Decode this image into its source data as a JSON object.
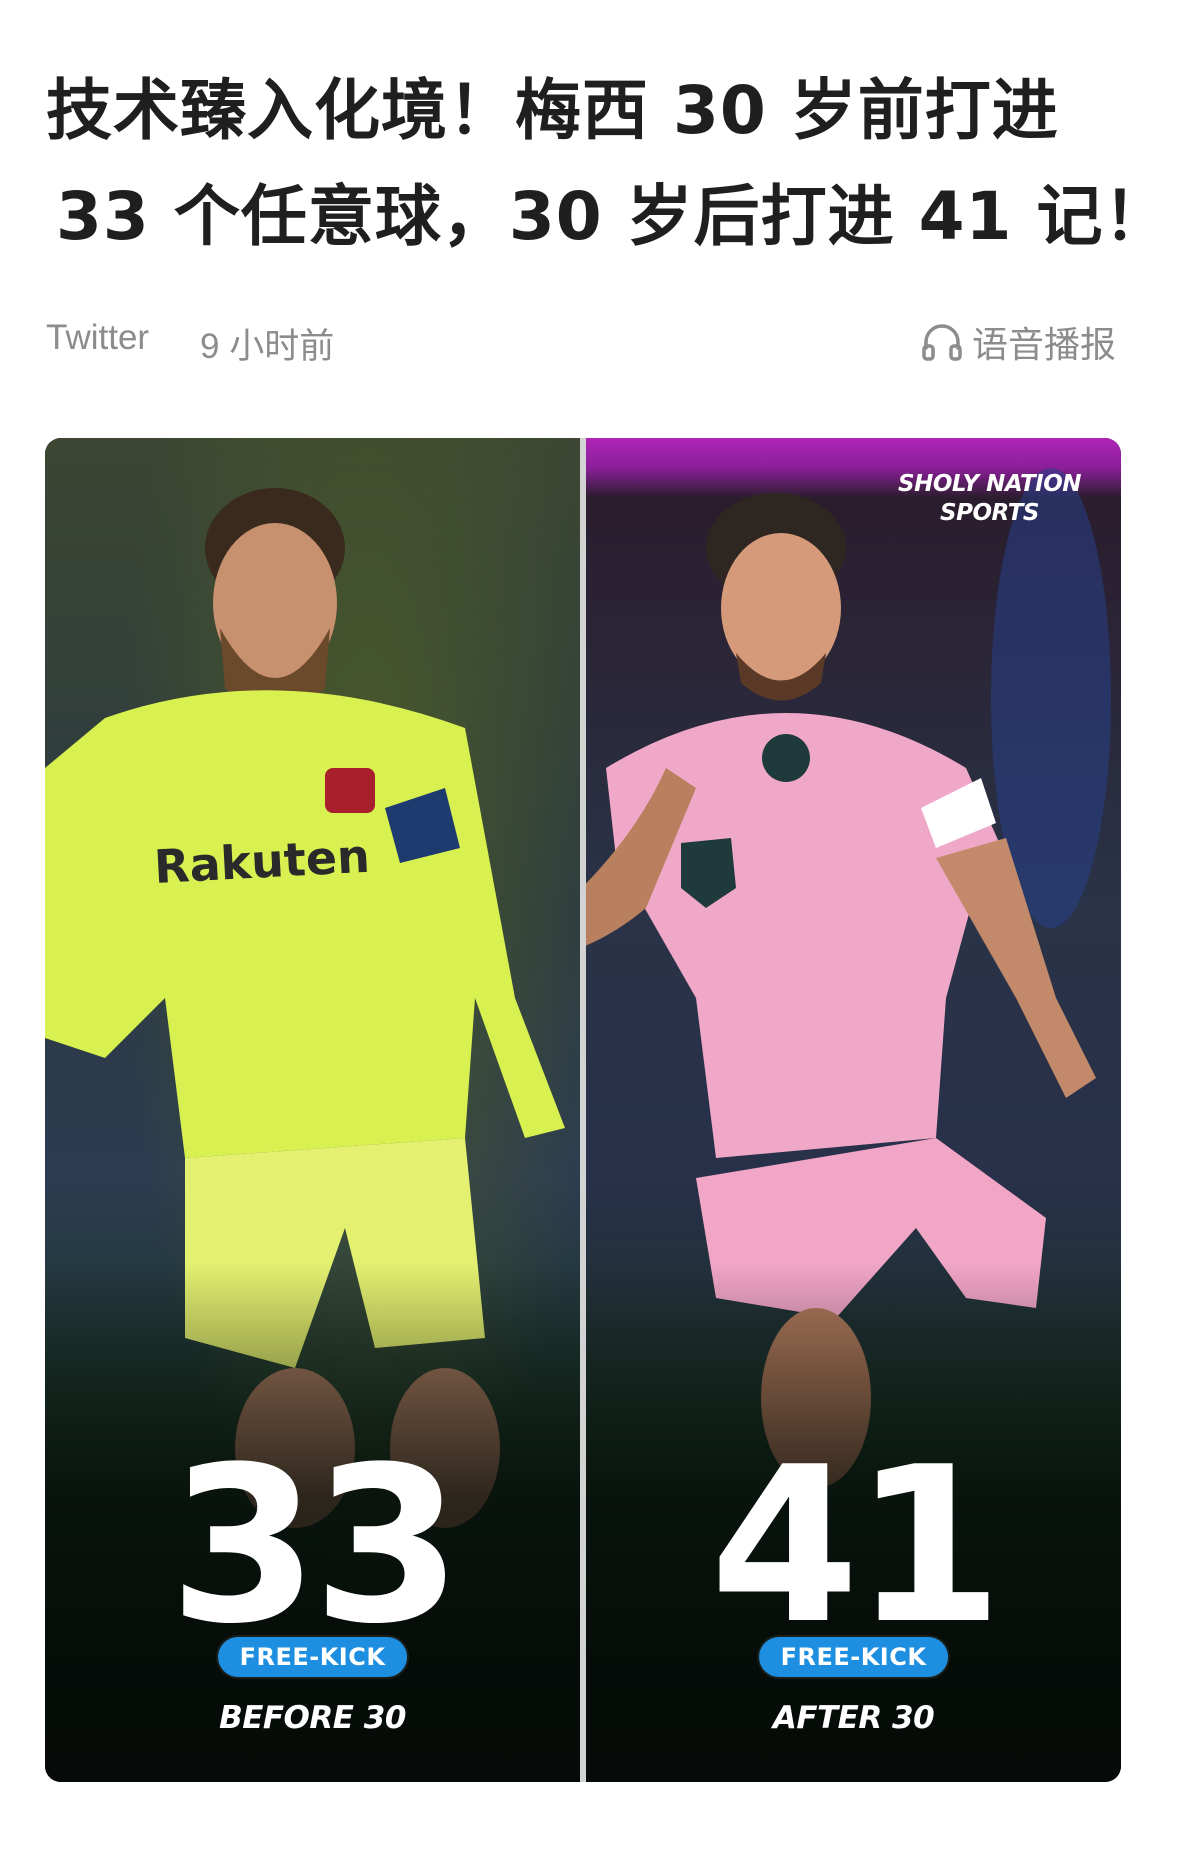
{
  "article": {
    "headline_line1": "技术臻入化境！梅西 30 岁前打进",
    "headline_line2": "33 个任意球，30 岁后打进 41 记！",
    "source": "Twitter",
    "time_ago": "9 小时前",
    "audio_label": "语音播报"
  },
  "hero": {
    "watermark_line1": "SHOLY NATION",
    "watermark_line2": "SPORTS",
    "left": {
      "number": "33",
      "tag": "FREE-KICK",
      "caption": "BEFORE 30",
      "kit_color": "#d8f050"
    },
    "right": {
      "number": "41",
      "tag": "FREE-KICK",
      "caption": "AFTER 30",
      "kit_color": "#f0a8c8"
    }
  },
  "colors": {
    "pill_blue": "#1e8fe0",
    "meta_gray": "#8c8c8c",
    "headline": "#1f1f1f"
  },
  "icons": {
    "audio": "headphones-icon"
  }
}
